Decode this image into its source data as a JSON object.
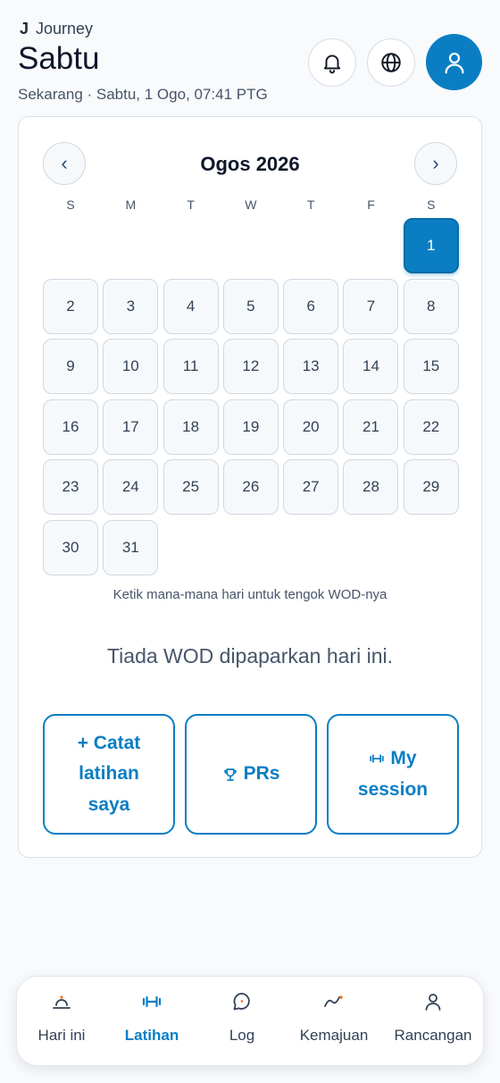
{
  "header": {
    "brand_mark": "J",
    "brand_name": "Journey",
    "title": "Sabtu",
    "subtitle": "Sekarang · Sabtu, 1 Ogo, 07:41 PTG",
    "icons": [
      "bell-icon",
      "globe-icon",
      "user-icon"
    ]
  },
  "calendar": {
    "month_label": "Ogos 2026",
    "prev_label": "‹",
    "next_label": "›",
    "weekdays": [
      "S",
      "M",
      "T",
      "W",
      "T",
      "F",
      "S"
    ],
    "leading_blanks": 6,
    "days": [
      "1",
      "2",
      "3",
      "4",
      "5",
      "6",
      "7",
      "8",
      "9",
      "10",
      "11",
      "12",
      "13",
      "14",
      "15",
      "16",
      "17",
      "18",
      "19",
      "20",
      "21",
      "22",
      "23",
      "24",
      "25",
      "26",
      "27",
      "28",
      "29",
      "30",
      "31"
    ],
    "selected_day": "1",
    "hint": "Ketik mana-mana hari untuk tengok WOD-nya"
  },
  "empty_state": "Tiada WOD dipaparkan hari ini.",
  "actions": {
    "log_label": "+ Catat latihan saya",
    "prs_label": "PRs",
    "session_label": "My session"
  },
  "tabbar": {
    "items": [
      {
        "label": "Hari ini",
        "icon": "sunrise-icon",
        "active": false
      },
      {
        "label": "Latihan",
        "icon": "dumbbell-icon",
        "active": true
      },
      {
        "label": "Log",
        "icon": "chat-icon",
        "active": false
      },
      {
        "label": "Kemajuan",
        "icon": "trend-icon",
        "active": false
      },
      {
        "label": "Rancangan",
        "icon": "person-icon",
        "active": false
      }
    ]
  },
  "colors": {
    "accent": "#0b7ec3",
    "background": "#f8fafc",
    "text_muted": "#475569"
  }
}
